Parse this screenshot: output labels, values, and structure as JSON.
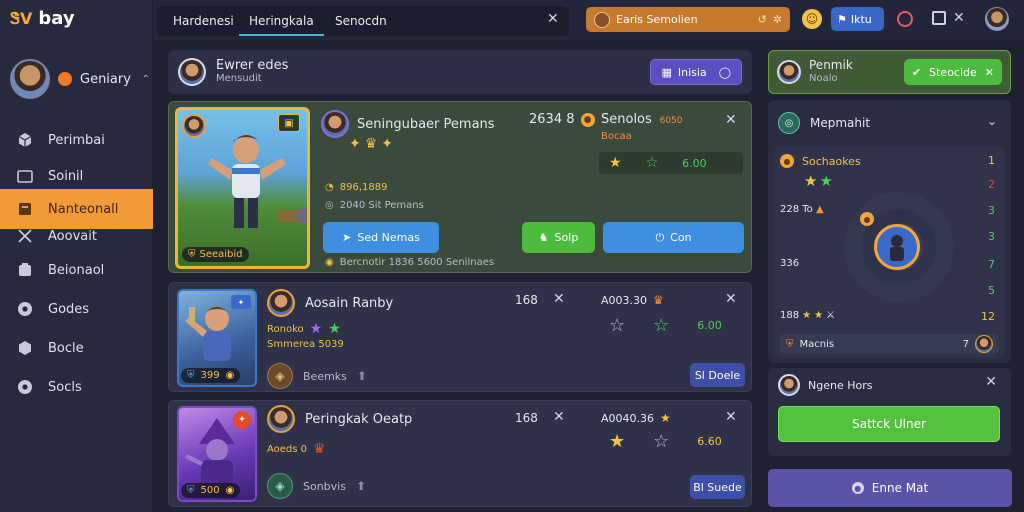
{
  "app": {
    "logo_mark": "ᏕV",
    "logo_text": "bay"
  },
  "colors": {
    "accent": "#f29a37",
    "green": "#4cbb3e",
    "blue": "#3f8fe0",
    "purple": "#5a4fc0",
    "bg": "#1f2132"
  },
  "sidebar": {
    "profile_name": "Geniary",
    "items": [
      {
        "label": "Perimbai",
        "icon": "cube-icon"
      },
      {
        "label": "Soinil",
        "icon": "folder-icon"
      },
      {
        "label": "Nanteonall",
        "icon": "book-icon"
      },
      {
        "label": "Aoovait",
        "icon": "swords-icon"
      },
      {
        "label": "Beionaol",
        "icon": "box-icon"
      },
      {
        "label": "Godes",
        "icon": "gear-icon"
      },
      {
        "label": "Bocle",
        "icon": "cube-icon"
      },
      {
        "label": "Socls",
        "icon": "gear-icon"
      }
    ]
  },
  "topbar": {
    "tabs": [
      "Hardenesi",
      "Heringkala",
      "Senocdn"
    ],
    "banner_text": "Earis Semolien",
    "pill_label": "Iktu"
  },
  "header": {
    "title": "Ewrer edes",
    "subtitle": "Mensudit",
    "button_label": "Inisia"
  },
  "featured": {
    "title": "Seningubaer Pemans",
    "score": "2634 8",
    "side_title": "Senolos",
    "side_sub": "Bocaa",
    "side_badge": "6050",
    "side_value": "6.00",
    "meta_1": "896,1889",
    "meta_2": "2040 Sit Pemans",
    "card_label": "Seeaibid",
    "footer": "Bercnotir 1836 5600 Senilnaes",
    "btn_blue_label": "Sed Nemas",
    "btn_green_label": "Solp",
    "btn_wide_label": "Con"
  },
  "cards": [
    {
      "title": "Aosain Ranby",
      "sub": "Ronoko",
      "sub2": "Smmerea 5039",
      "count": "168",
      "price": "A003.30",
      "value": "6.00",
      "badge": "399",
      "pool_label": "Beemks",
      "action": "Sl Doele"
    },
    {
      "title": "Peringkak Oeatp",
      "sub": "Aoeds 0",
      "sub2": "",
      "count": "168",
      "price": "A0040.36",
      "value": "6.60",
      "badge": "500",
      "pool_label": "Sonbvis",
      "action": "Bl Suede"
    }
  ],
  "right": {
    "profile_name": "Penmik",
    "profile_sub": "Noalo",
    "claim_label": "Steocide",
    "panel_title": "Mepmahit",
    "list_title": "Sochaokes",
    "rows": [
      "228 To",
      "336",
      "188"
    ],
    "nums": [
      "1",
      "2",
      "3",
      "3",
      "7",
      "5",
      "12"
    ],
    "footer_label": "Macnis",
    "footer_num": "7",
    "card2_title": "Ngene Hors",
    "card2_button": "Sattck Ulner",
    "bottom_button": "Enne Mat"
  }
}
